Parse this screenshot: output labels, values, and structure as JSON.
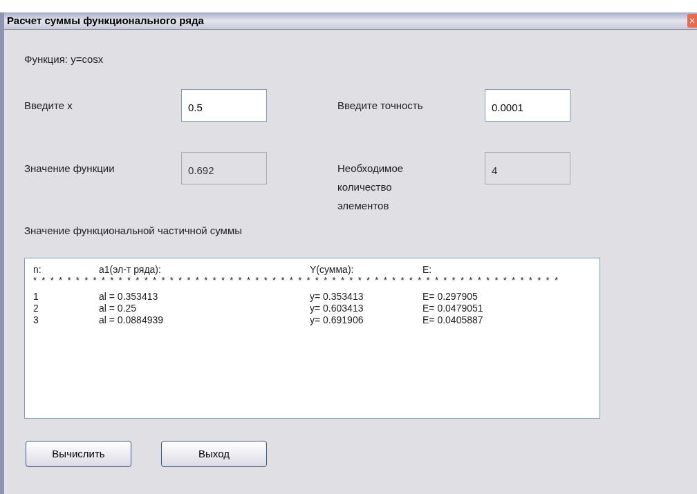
{
  "window": {
    "title": "Расчет суммы функционального ряда",
    "close": "×"
  },
  "function_label": "Функция: y=cosx",
  "fields": [
    {
      "label": "Введите x",
      "value": "0.5",
      "disabled": false
    },
    {
      "label": "Введите точность",
      "value": "0.0001",
      "disabled": false
    },
    {
      "label": "Значение функции",
      "value": "0.692",
      "disabled": true
    },
    {
      "label": "Необходимое количество элементов",
      "value": "4",
      "disabled": true
    }
  ],
  "results_label": "Значение функциональной частичной суммы",
  "results": {
    "columns": [
      "n:",
      "a1(эл-т ряда):",
      "Y(сумма):",
      "E:"
    ],
    "separator": "**************************************************************",
    "rows": [
      [
        "1",
        "al = 0.353413",
        "y= 0.353413",
        "E= 0.297905"
      ],
      [
        "2",
        "al = 0.25",
        "y= 0.603413",
        "E= 0.0479051"
      ],
      [
        "3",
        "al = 0.0884939",
        "y= 0.691906",
        "E= 0.0405887"
      ]
    ]
  },
  "buttons": [
    "Вычислить",
    "Выход"
  ]
}
